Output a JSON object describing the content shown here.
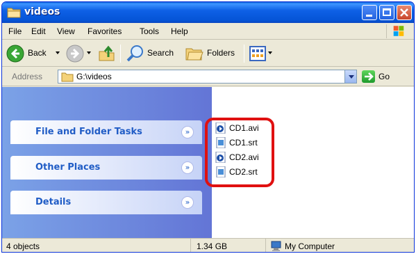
{
  "window": {
    "title": "videos"
  },
  "menu": {
    "items": [
      "File",
      "Edit",
      "View",
      "Favorites",
      "Tools",
      "Help"
    ]
  },
  "toolbar": {
    "back_label": "Back",
    "search_label": "Search",
    "folders_label": "Folders",
    "icons": [
      "back-arrow-icon",
      "forward-arrow-icon",
      "up-folder-icon",
      "search-icon",
      "folders-icon",
      "views-icon"
    ]
  },
  "address": {
    "label": "Address",
    "value": "G:\\videos",
    "go_label": "Go"
  },
  "tasks": {
    "file_folder": "File and Folder Tasks",
    "other_places": "Other Places",
    "details": "Details"
  },
  "files": [
    {
      "name": "CD1.avi",
      "icon": "video-file-icon"
    },
    {
      "name": "CD1.srt",
      "icon": "text-file-icon"
    },
    {
      "name": "CD2.avi",
      "icon": "video-file-icon"
    },
    {
      "name": "CD2.srt",
      "icon": "text-file-icon"
    }
  ],
  "status": {
    "objects": "4 objects",
    "size": "1.34 GB",
    "location": "My Computer"
  },
  "colors": {
    "titlebar": "#0554d6",
    "taskpane": "#6375d6",
    "task_title": "#215dc6",
    "highlight": "#e01010"
  }
}
